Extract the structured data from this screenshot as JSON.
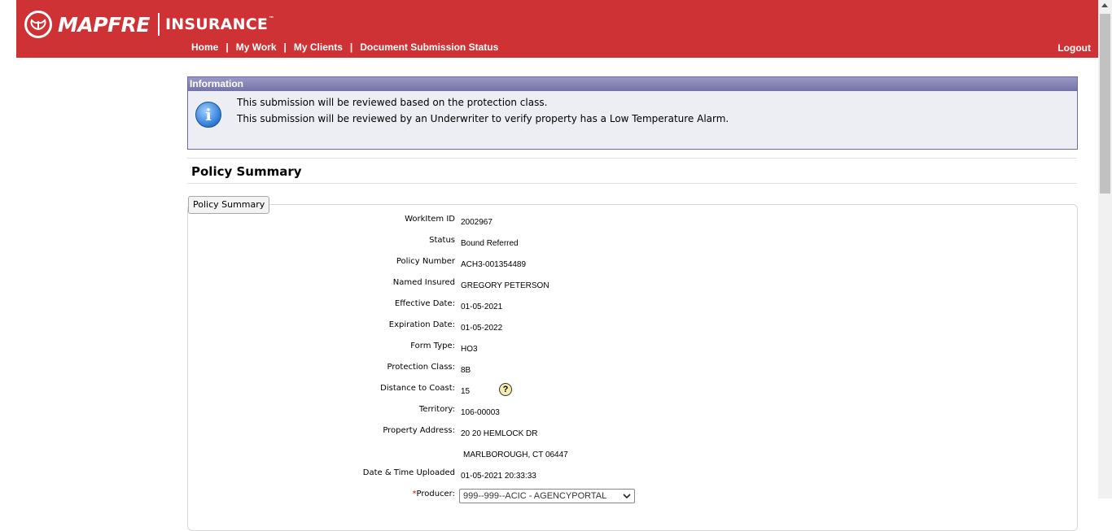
{
  "header": {
    "brand": "MAPFRE",
    "brand_sub": "INSURANCE",
    "tm": "™",
    "nav": [
      "Home",
      "My Work",
      "My Clients",
      "Document Submission Status"
    ],
    "nav_sep": "|",
    "logout": "Logout"
  },
  "info": {
    "title": "Information",
    "icon_glyph": "i",
    "lines": [
      "This submission will be reviewed based on the protection class.",
      "This submission will be reviewed by an Underwriter to verify property has a Low Temperature Alarm."
    ]
  },
  "summary": {
    "heading": "Policy Summary",
    "tab": "Policy Summary",
    "fields": [
      {
        "label": "WorkItem ID",
        "value": "2002967"
      },
      {
        "label": "Status",
        "value": "Bound Referred"
      },
      {
        "label": "Policy Number",
        "value": "ACH3-001354489"
      },
      {
        "label": "Named Insured",
        "value": "GREGORY PETERSON"
      },
      {
        "label": "Effective Date:",
        "value": "01-05-2021"
      },
      {
        "label": "Expiration Date:",
        "value": "01-05-2022"
      },
      {
        "label": "Form Type:",
        "value": "HO3"
      },
      {
        "label": "Protection Class:",
        "value": "8B"
      },
      {
        "label": "Distance to Coast:",
        "value": "15"
      },
      {
        "label": "Territory:",
        "value": "106-00003"
      },
      {
        "label": "Property Address:",
        "value": "20 20 HEMLOCK DR"
      },
      {
        "label": "",
        "value": "MARLBOROUGH, CT 06447"
      },
      {
        "label": "Date & Time Uploaded",
        "value": "01-05-2021 20:33:33"
      }
    ],
    "help_glyph": "?",
    "producer": {
      "required_mark": "*",
      "label": "Producer:",
      "selected": "999--999--ACIC - AGENCYPORTAL"
    }
  }
}
